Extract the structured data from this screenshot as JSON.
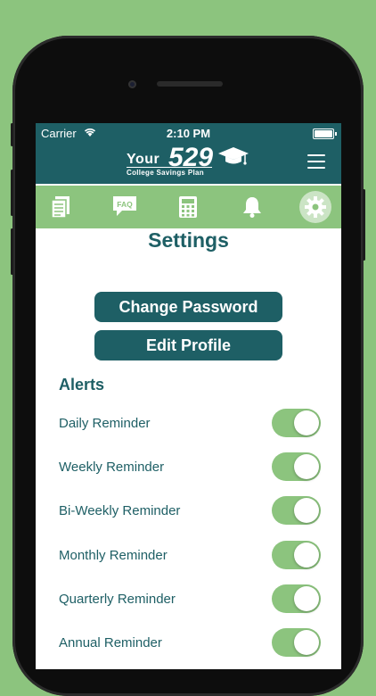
{
  "status_bar": {
    "carrier": "Carrier",
    "time": "2:10 PM"
  },
  "header": {
    "logo_your": "Your",
    "logo_number": "529",
    "logo_subtitle": "College Savings Plan"
  },
  "nav_icons": [
    "document-icon",
    "faq-icon",
    "calculator-icon",
    "bell-icon",
    "gear-icon"
  ],
  "nav_faq_label": "FAQ",
  "page": {
    "title": "Settings",
    "change_password_label": "Change Password",
    "edit_profile_label": "Edit Profile"
  },
  "alerts": {
    "heading": "Alerts",
    "items": [
      {
        "label": "Daily Reminder",
        "on": true
      },
      {
        "label": "Weekly Reminder",
        "on": true
      },
      {
        "label": "Bi-Weekly Reminder",
        "on": true
      },
      {
        "label": "Monthly Reminder",
        "on": true
      },
      {
        "label": "Quarterly Reminder",
        "on": true
      },
      {
        "label": "Annual Reminder",
        "on": true
      }
    ]
  },
  "colors": {
    "brand_teal": "#1e5f65",
    "accent_green": "#8cc47e",
    "background": "#ffffff"
  }
}
